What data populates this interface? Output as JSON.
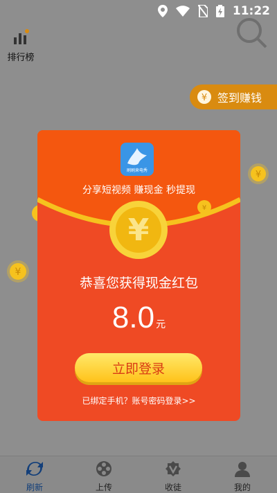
{
  "status_bar": {
    "time": "11:22"
  },
  "topbar": {
    "rank_label": "排行榜"
  },
  "sign_in": {
    "label": "签到赚钱"
  },
  "modal": {
    "app_icon_text": "刷刷来电秀",
    "slogan": "分享短视频 赚现金 秒提现",
    "congrats": "恭喜您获得现金红包",
    "amount": "8.0",
    "unit": "元",
    "login_button": "立即登录",
    "bound_link": "已绑定手机？账号密码登录>>"
  },
  "bottom_nav": [
    {
      "label": "刷新",
      "icon": "refresh-icon",
      "active": true
    },
    {
      "label": "上传",
      "icon": "film-reel-icon",
      "active": false
    },
    {
      "label": "收徒",
      "icon": "badge-v-icon",
      "active": false
    },
    {
      "label": "我的",
      "icon": "user-icon",
      "active": false
    }
  ],
  "colors": {
    "modal": "#ef4a24",
    "button": "#ffc21a",
    "coin": "#f6c21e"
  }
}
